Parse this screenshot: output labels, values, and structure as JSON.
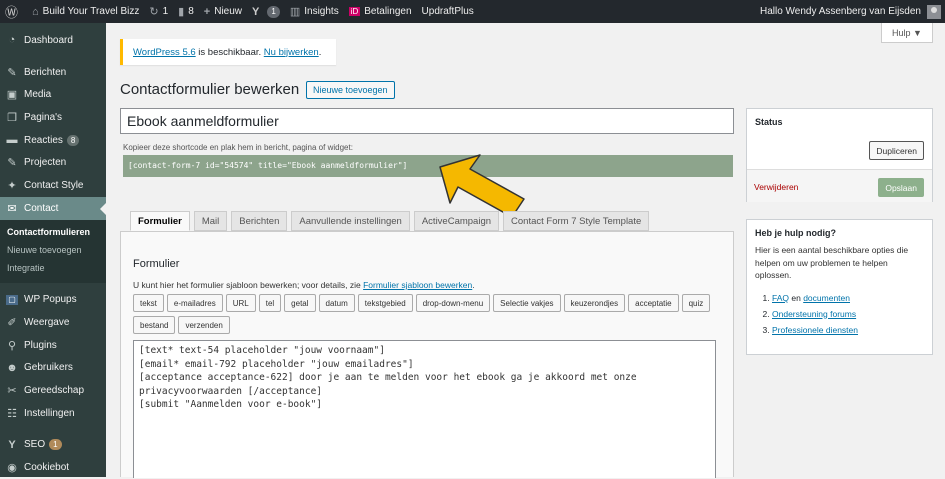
{
  "admin_bar": {
    "site_name": "Build Your Travel Bizz",
    "updates_count": "1",
    "comments_count": "8",
    "new_label": "Nieuw",
    "yoast_badge": "1",
    "insights_label": "Insights",
    "betalingen_label": "Betalingen",
    "updraft_label": "UpdraftPlus",
    "greeting": "Hallo Wendy Assenberg van Eijsden"
  },
  "sidebar": {
    "items": [
      {
        "label": "Dashboard",
        "icon": "dashboard-icon"
      },
      {
        "label": "Berichten",
        "icon": "pin-icon"
      },
      {
        "label": "Media",
        "icon": "media-icon"
      },
      {
        "label": "Pagina's",
        "icon": "pages-icon"
      },
      {
        "label": "Reacties",
        "icon": "comments-icon",
        "badge": "8"
      },
      {
        "label": "Projecten",
        "icon": "pin-icon"
      },
      {
        "label": "Contact Style",
        "icon": "twitter-icon"
      },
      {
        "label": "Contact",
        "icon": "mail-icon"
      }
    ],
    "submenu": [
      "Contactformulieren",
      "Nieuwe toevoegen",
      "Integratie"
    ],
    "items2": [
      {
        "label": "WP Popups",
        "icon": "popup-icon"
      },
      {
        "label": "Weergave",
        "icon": "brush-icon"
      },
      {
        "label": "Plugins",
        "icon": "plugin-icon"
      },
      {
        "label": "Gebruikers",
        "icon": "users-icon"
      },
      {
        "label": "Gereedschap",
        "icon": "tools-icon"
      },
      {
        "label": "Instellingen",
        "icon": "settings-icon"
      },
      {
        "label": "SEO",
        "icon": "yoast-icon",
        "badge": "1"
      },
      {
        "label": "Cookiebot",
        "icon": "cookie-icon"
      }
    ]
  },
  "help_tab": "Hulp ▼",
  "notice": {
    "link": "WordPress 5.6",
    "text": " is beschikbaar. ",
    "action": "Nu bijwerken",
    "end": "."
  },
  "page": {
    "title": "Contactformulier bewerken",
    "add_new": "Nieuwe toevoegen",
    "form_title": "Ebook aanmeldformulier",
    "shortcode_label": "Kopieer deze shortcode en plak hem in bericht, pagina of widget:",
    "shortcode": "[contact-form-7 id=\"54574\" title=\"Ebook aanmeldformulier\"]"
  },
  "tabs": [
    "Formulier",
    "Mail",
    "Berichten",
    "Aanvullende instellingen",
    "ActiveCampaign",
    "Contact Form 7 Style Template"
  ],
  "form_panel": {
    "heading": "Formulier",
    "desc_text": "U kunt hier het formulier sjabloon bewerken; voor details, zie ",
    "desc_link": "Formulier sjabloon bewerken",
    "desc_end": ".",
    "tags": [
      "tekst",
      "e-mailadres",
      "URL",
      "tel",
      "getal",
      "datum",
      "tekstgebied",
      "drop-down-menu",
      "Selectie vakjes",
      "keuzerondjes",
      "acceptatie",
      "quiz",
      "bestand",
      "verzenden"
    ],
    "code": "[text* text-54 placeholder \"jouw voornaam\"]\n[email* email-792 placeholder \"jouw emailadres\"]\n[acceptance acceptance-622] door je aan te melden voor het ebook ga je akkoord met onze\nprivacyvoorwaarden [/acceptance]\n[submit \"Aanmelden voor e-book\"]"
  },
  "status_box": {
    "title": "Status",
    "duplicate": "Dupliceren",
    "delete": "Verwijderen",
    "save": "Opslaan"
  },
  "help_box": {
    "title": "Heb je hulp nodig?",
    "text": "Hier is een aantal beschikbare opties die helpen om uw problemen te helpen oplossen.",
    "item1_a": "FAQ",
    "item1_mid": " en ",
    "item1_b": "documenten",
    "item2": "Ondersteuning forums",
    "item3": "Professionele diensten"
  },
  "colors": {
    "accent": "#0073aa",
    "sidebar": "#2f3f3e",
    "shortcode_bg": "#8da48c",
    "arrow": "#f5b800"
  }
}
